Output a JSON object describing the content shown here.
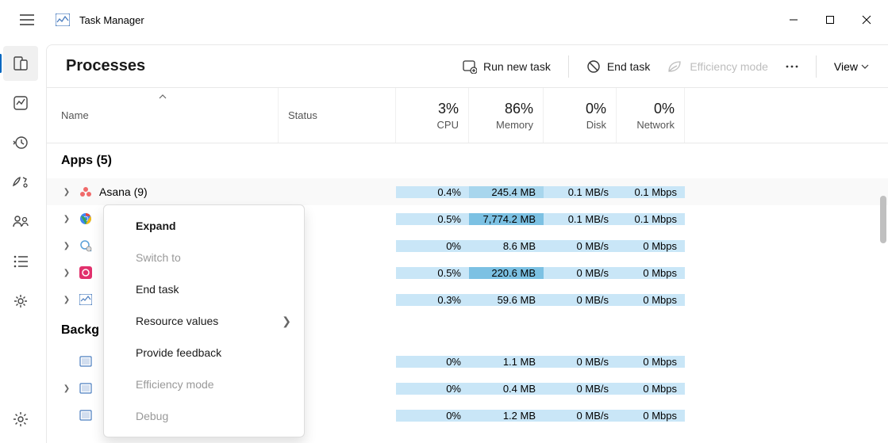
{
  "app": {
    "title": "Task Manager"
  },
  "toolbar": {
    "page_title": "Processes",
    "run_new_task": "Run new task",
    "end_task": "End task",
    "efficiency_mode": "Efficiency mode",
    "view": "View"
  },
  "columns": {
    "name": "Name",
    "status": "Status",
    "cpu": {
      "pct": "3%",
      "label": "CPU"
    },
    "memory": {
      "pct": "86%",
      "label": "Memory"
    },
    "disk": {
      "pct": "0%",
      "label": "Disk"
    },
    "network": {
      "pct": "0%",
      "label": "Network"
    }
  },
  "groups": {
    "apps": "Apps (5)",
    "background": "Backg"
  },
  "processes": [
    {
      "name": "Asana (9)",
      "cpu": "0.4%",
      "mem": "245.4 MB",
      "disk": "0.1 MB/s",
      "net": "0.1 Mbps",
      "mem_shade": "med"
    },
    {
      "name": "",
      "cpu": "0.5%",
      "mem": "7,774.2 MB",
      "disk": "0.1 MB/s",
      "net": "0.1 Mbps",
      "mem_shade": "dark"
    },
    {
      "name": "",
      "cpu": "0%",
      "mem": "8.6 MB",
      "disk": "0 MB/s",
      "net": "0 Mbps",
      "mem_shade": "light"
    },
    {
      "name": "",
      "cpu": "0.5%",
      "mem": "220.6 MB",
      "disk": "0 MB/s",
      "net": "0 Mbps",
      "mem_shade": "dark"
    },
    {
      "name": "",
      "cpu": "0.3%",
      "mem": "59.6 MB",
      "disk": "0 MB/s",
      "net": "0 Mbps",
      "mem_shade": "light"
    }
  ],
  "background": [
    {
      "cpu": "0%",
      "mem": "1.1 MB",
      "disk": "0 MB/s",
      "net": "0 Mbps"
    },
    {
      "cpu": "0%",
      "mem": "0.4 MB",
      "disk": "0 MB/s",
      "net": "0 Mbps"
    },
    {
      "cpu": "0%",
      "mem": "1.2 MB",
      "disk": "0 MB/s",
      "net": "0 Mbps"
    }
  ],
  "context_menu": {
    "expand": "Expand",
    "switch_to": "Switch to",
    "end_task": "End task",
    "resource_values": "Resource values",
    "provide_feedback": "Provide feedback",
    "efficiency_mode": "Efficiency mode",
    "debug": "Debug"
  }
}
